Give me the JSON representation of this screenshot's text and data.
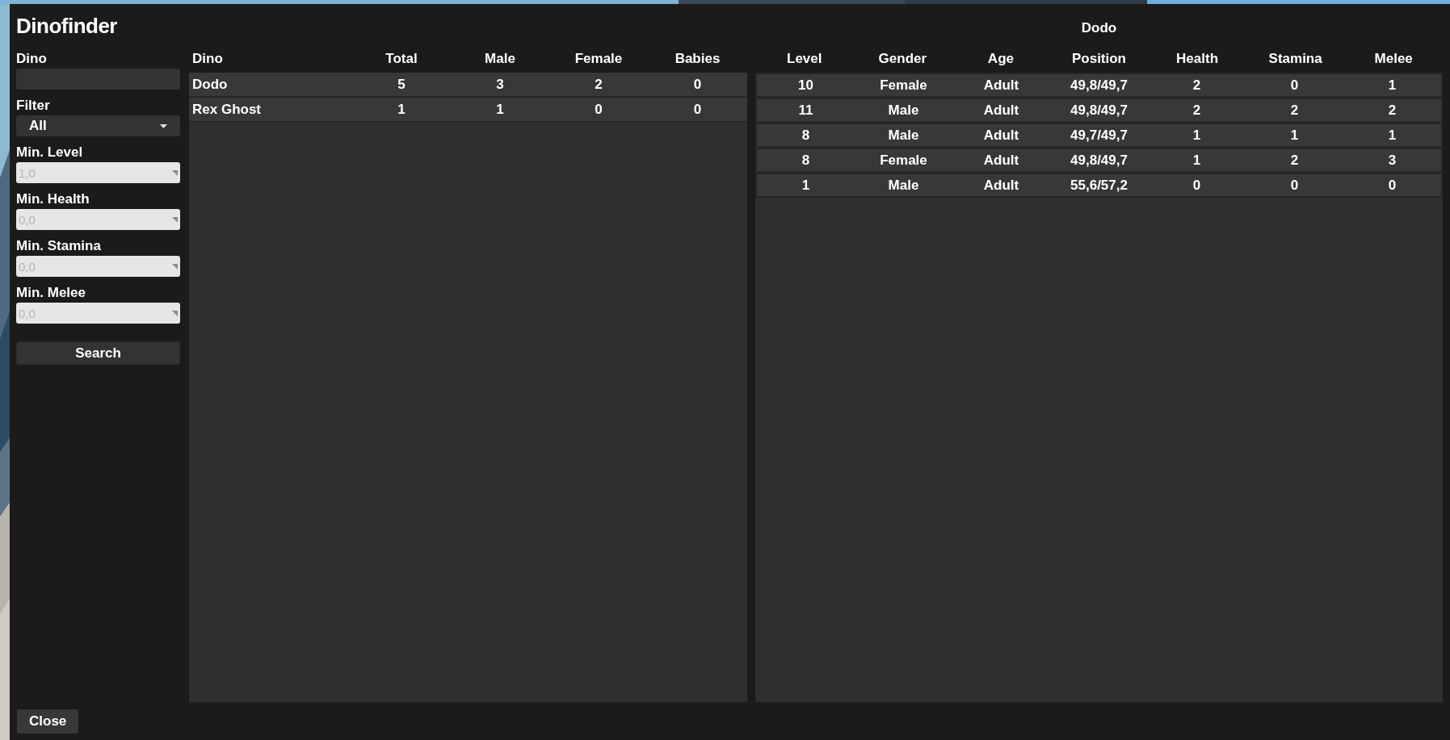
{
  "window": {
    "title": "Dinofinder"
  },
  "fields": [
    {
      "kind": "text",
      "label": "Dino"
    },
    {
      "kind": "select",
      "label": "Filter",
      "value": "All"
    },
    {
      "kind": "number",
      "label": "Min. Level",
      "placeholder": "1,0"
    },
    {
      "kind": "number",
      "label": "Min. Health",
      "placeholder": "0,0"
    },
    {
      "kind": "number",
      "label": "Min. Stamina",
      "placeholder": "0,0"
    },
    {
      "kind": "number",
      "label": "Min. Melee",
      "placeholder": "0,0"
    }
  ],
  "search_button": "Search",
  "species_table": {
    "columns": [
      "Dino",
      "Total",
      "Male",
      "Female",
      "Babies"
    ],
    "rows": [
      [
        "Dodo",
        "5",
        "3",
        "2",
        "0"
      ],
      [
        "Rex Ghost",
        "1",
        "1",
        "0",
        "0"
      ]
    ]
  },
  "detail_table": {
    "title": "Dodo",
    "columns": [
      "Level",
      "Gender",
      "Age",
      "Position",
      "Health",
      "Stamina",
      "Melee"
    ],
    "rows": [
      [
        "10",
        "Female",
        "Adult",
        "49,8/49,7",
        "2",
        "0",
        "1"
      ],
      [
        "11",
        "Male",
        "Adult",
        "49,8/49,7",
        "2",
        "2",
        "2"
      ],
      [
        "8",
        "Male",
        "Adult",
        "49,7/49,7",
        "1",
        "1",
        "1"
      ],
      [
        "8",
        "Female",
        "Adult",
        "49,8/49,7",
        "1",
        "2",
        "3"
      ],
      [
        "1",
        "Male",
        "Adult",
        "55,6/57,2",
        "0",
        "0",
        "0"
      ]
    ]
  },
  "close_button": "Close"
}
